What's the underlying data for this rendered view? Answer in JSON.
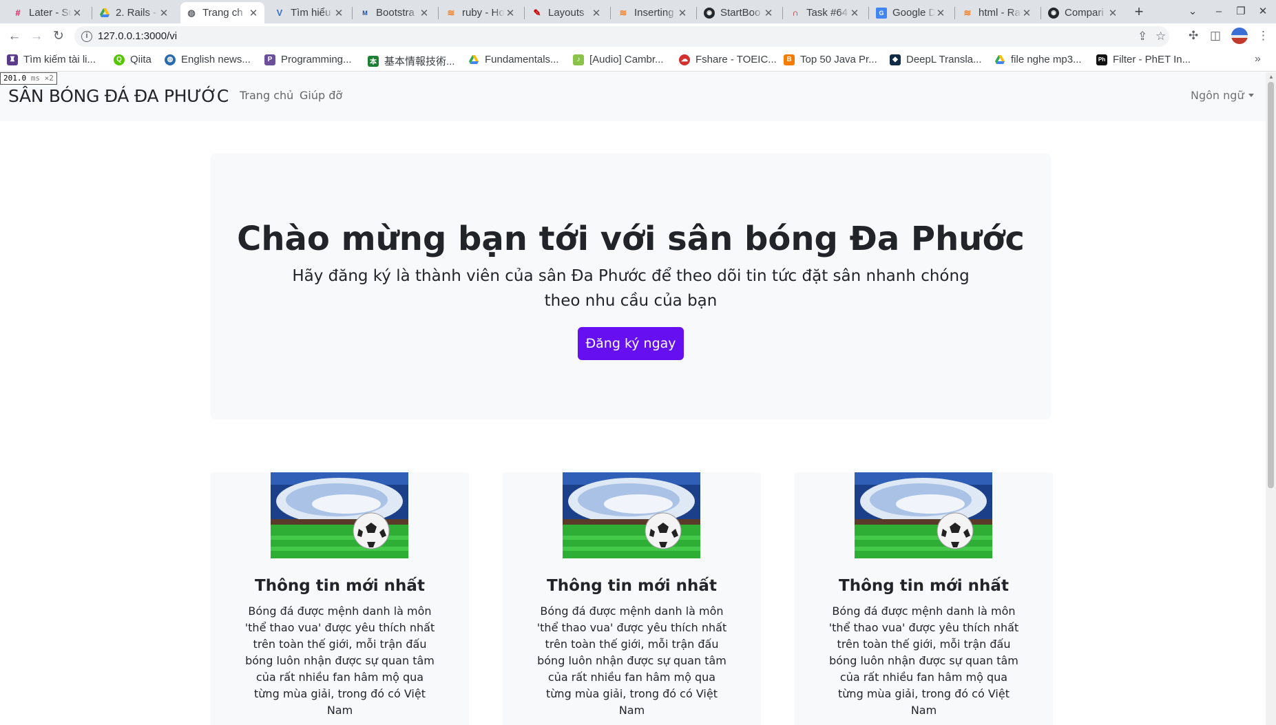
{
  "browser": {
    "tabs": [
      {
        "title": "Later - Su",
        "icon": "slack-icon"
      },
      {
        "title": "2. Rails - ",
        "icon": "drive-icon"
      },
      {
        "title": "Trang ch",
        "icon": "globe-icon"
      },
      {
        "title": "Tìm hiểu",
        "icon": "viblo-icon"
      },
      {
        "title": "Bootstra",
        "icon": "mdn-icon"
      },
      {
        "title": "ruby - Ho",
        "icon": "stackoverflow-icon"
      },
      {
        "title": "Layouts",
        "icon": "rails-icon"
      },
      {
        "title": "Inserting",
        "icon": "stackoverflow-icon"
      },
      {
        "title": "StartBoo",
        "icon": "github-icon"
      },
      {
        "title": "Task #64",
        "icon": "redmine-icon"
      },
      {
        "title": "Google D",
        "icon": "google-docs-icon"
      },
      {
        "title": "html - Ra",
        "icon": "stackoverflow-icon"
      },
      {
        "title": "Compari",
        "icon": "github-icon"
      }
    ],
    "url": "127.0.0.1:3000/vi",
    "bookmarks": [
      {
        "label": "Tìm kiếm tài li...",
        "icon": "bookmark-icon"
      },
      {
        "label": "Qiita",
        "icon": "qiita-icon"
      },
      {
        "label": "English news...",
        "icon": "globe-icon"
      },
      {
        "label": "Programming...",
        "icon": "programming-icon"
      },
      {
        "label": "基本情報技術...",
        "icon": "book-icon"
      },
      {
        "label": "Fundamentals...",
        "icon": "drive-icon"
      },
      {
        "label": "[Audio] Cambr...",
        "icon": "audio-icon"
      },
      {
        "label": "Fshare - TOEIC...",
        "icon": "fshare-icon"
      },
      {
        "label": "Top 50 Java Pr...",
        "icon": "blogger-icon"
      },
      {
        "label": "DeepL Transla...",
        "icon": "deepl-icon"
      },
      {
        "label": "file nghe mp3...",
        "icon": "drive-icon"
      },
      {
        "label": "Filter - PhET In...",
        "icon": "phet-icon"
      }
    ]
  },
  "perf": {
    "time": "201.0",
    "unit": "ms ×2"
  },
  "site": {
    "brand": "SÂN BÓNG ĐÁ ĐA PHƯỚC",
    "nav": [
      "Trang chủ",
      "Giúp đỡ"
    ],
    "language": "Ngôn ngữ"
  },
  "hero": {
    "title": "Chào mừng bạn tới với sân bóng Đa Phước",
    "subtitle": "Hãy đăng ký là thành viên của sân Đa Phước để theo dõi tin tức đặt sân nhanh chóng theo nhu cầu của bạn",
    "cta": "Đăng ký ngay"
  },
  "cards": [
    {
      "title": "Thông tin mới nhất",
      "text": "Bóng đá được mệnh danh là môn 'thể thao vua' được yêu thích nhất trên toàn thế giới, mỗi trận đấu bóng luôn nhận được sự quan tâm của rất nhiều fan hâm mộ qua từng mùa giải, trong đó có Việt Nam"
    },
    {
      "title": "Thông tin mới nhất",
      "text": "Bóng đá được mệnh danh là môn 'thể thao vua' được yêu thích nhất trên toàn thế giới, mỗi trận đấu bóng luôn nhận được sự quan tâm của rất nhiều fan hâm mộ qua từng mùa giải, trong đó có Việt Nam"
    },
    {
      "title": "Thông tin mới nhất",
      "text": "Bóng đá được mệnh danh là môn 'thể thao vua' được yêu thích nhất trên toàn thế giới, mỗi trận đấu bóng luôn nhận được sự quan tâm của rất nhiều fan hâm mộ qua từng mùa giải, trong đó có Việt Nam"
    }
  ],
  "colors": {
    "primary": "#6610f2",
    "light": "#f8f9fa",
    "text": "#212529"
  }
}
